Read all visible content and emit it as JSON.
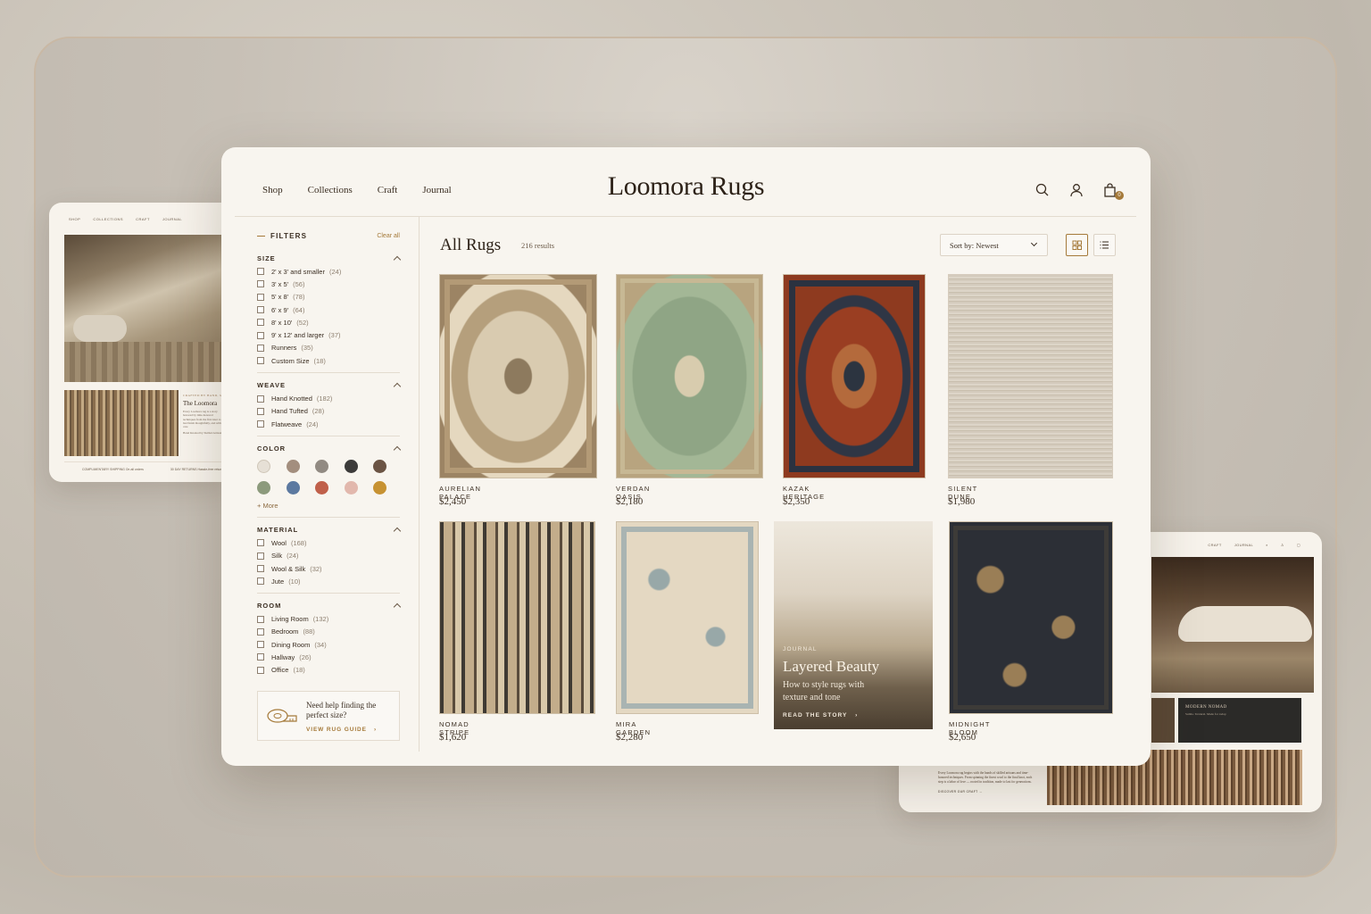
{
  "brand": "Loomora Rugs",
  "nav": [
    "Shop",
    "Collections",
    "Craft",
    "Journal"
  ],
  "header_icons": [
    "search-icon",
    "account-icon",
    "cart-icon"
  ],
  "cart_count": "0",
  "filters": {
    "title": "FILTERS",
    "clear_all": "Clear all",
    "size": {
      "title": "SIZE",
      "options": [
        {
          "label": "2' x 3' and smaller",
          "count": "(24)"
        },
        {
          "label": "3' x 5'",
          "count": "(56)"
        },
        {
          "label": "5' x 8'",
          "count": "(78)"
        },
        {
          "label": "6' x 9'",
          "count": "(64)"
        },
        {
          "label": "8' x 10'",
          "count": "(52)"
        },
        {
          "label": "9' x 12' and larger",
          "count": "(37)"
        },
        {
          "label": "Runners",
          "count": "(35)"
        },
        {
          "label": "Custom Size",
          "count": "(18)"
        }
      ]
    },
    "weave": {
      "title": "WEAVE",
      "options": [
        {
          "label": "Hand Knotted",
          "count": "(182)"
        },
        {
          "label": "Hand Tufted",
          "count": "(28)"
        },
        {
          "label": "Flatweave",
          "count": "(24)"
        }
      ]
    },
    "color": {
      "title": "COLOR",
      "swatches": [
        "#e6e0d6",
        "#a38e7e",
        "#918a82",
        "#3c3b3a",
        "#6b5444",
        "#8c9a7c",
        "#5c79a0",
        "#c0604a",
        "#e2b8ad",
        "#c79232"
      ],
      "more": "+ More"
    },
    "material": {
      "title": "MATERIAL",
      "options": [
        {
          "label": "Wool",
          "count": "(168)"
        },
        {
          "label": "Silk",
          "count": "(24)"
        },
        {
          "label": "Wool & Silk",
          "count": "(32)"
        },
        {
          "label": "Jute",
          "count": "(10)"
        }
      ]
    },
    "room": {
      "title": "ROOM",
      "options": [
        {
          "label": "Living Room",
          "count": "(132)"
        },
        {
          "label": "Bedroom",
          "count": "(88)"
        },
        {
          "label": "Dining Room",
          "count": "(34)"
        },
        {
          "label": "Hallway",
          "count": "(26)"
        },
        {
          "label": "Office",
          "count": "(18)"
        }
      ]
    },
    "help": {
      "text": "Need help finding the perfect size?",
      "link": "VIEW RUG GUIDE"
    }
  },
  "listing": {
    "title": "All Rugs",
    "count": "216 results",
    "sort": "Sort by: Newest",
    "products": [
      {
        "name": "AURELIAN PALACE",
        "price": "$2,450"
      },
      {
        "name": "VERDAN OASIS",
        "price": "$2,180"
      },
      {
        "name": "KAZAK HERITAGE",
        "price": "$2,350"
      },
      {
        "name": "SILENT DUNE",
        "price": "$1,980"
      },
      {
        "name": "NOMAD STRIPE",
        "price": "$1,620"
      },
      {
        "name": "MIRA GARDEN",
        "price": "$2,280"
      },
      {
        "name": "MIDNIGHT BLOOM",
        "price": "$2,650"
      }
    ],
    "journal": {
      "kicker": "JOURNAL",
      "title": "Layered Beauty",
      "text": "How to style rugs with texture and tone",
      "link": "READ THE STORY"
    }
  },
  "left_preview": {
    "nav": [
      "SHOP",
      "COLLECTIONS",
      "CRAFT",
      "JOURNAL"
    ],
    "kicker": "CRAFTED BY HAND, M",
    "title": "The Loomora",
    "text": "Every Loomora rug is a story honored by time-honored techniques from the first knot to the last finish thoughtfully, and with care",
    "signature": "Hand Knotted by Skilled Artisans",
    "footer": [
      "COMPLIMENTARY SHIPPING On all orders",
      "30 DAY RETURNS Hassle-free returns"
    ]
  },
  "right_preview": {
    "nav": [
      "CRAFT",
      "JOURNAL"
    ],
    "dark_title": "MODERN NOMAD",
    "dark_text": "Subtle. Textural. Made for today.",
    "text": "Every Loomora rug begins with the hands of skilled artisans and time-honored techniques. From spinning the finest wool to the final knot, each step is a labor of love — rooted in tradition, made to last for generations.",
    "link": "DISCOVER OUR CRAFT →"
  }
}
